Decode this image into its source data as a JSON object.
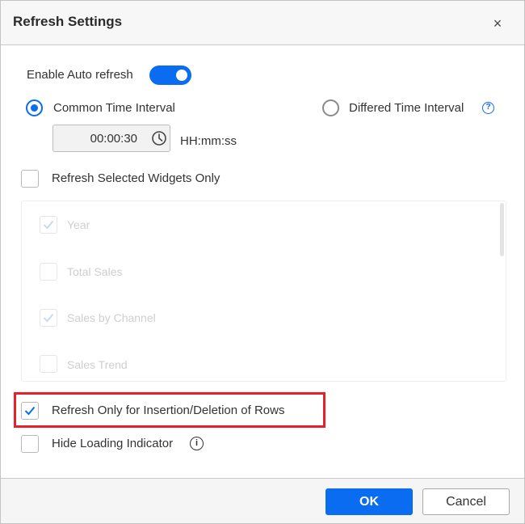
{
  "dialog": {
    "title": "Refresh Settings",
    "close_glyph": "×"
  },
  "auto_refresh": {
    "label": "Enable Auto refresh",
    "enabled": true
  },
  "interval_mode": {
    "common_label": "Common Time Interval",
    "differed_label": "Differed Time Interval",
    "selected": "common"
  },
  "time_input": {
    "value": "00:00:30",
    "format_label": "HH:mm:ss"
  },
  "selected_widgets": {
    "label": "Refresh Selected Widgets Only",
    "checked": false,
    "items": [
      {
        "label": "Year",
        "checked": true
      },
      {
        "label": "Total Sales",
        "checked": false
      },
      {
        "label": "Sales by Channel",
        "checked": true
      },
      {
        "label": "Sales Trend",
        "checked": false
      }
    ]
  },
  "insertion_deletion": {
    "label": "Refresh Only for Insertion/Deletion of Rows",
    "checked": true
  },
  "hide_loading": {
    "label": "Hide Loading Indicator",
    "checked": false
  },
  "footer": {
    "ok_label": "OK",
    "cancel_label": "Cancel"
  },
  "colors": {
    "accent": "#0a6cf0",
    "highlight": "#e8202a"
  }
}
